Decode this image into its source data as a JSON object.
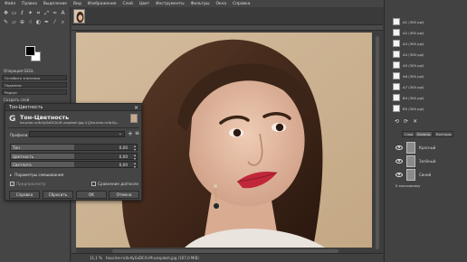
{
  "menubar": [
    "Файл",
    "Правка",
    "Выделение",
    "Вид",
    "Изображение",
    "Слой",
    "Цвет",
    "Инструменты",
    "Фильтры",
    "Окна",
    "Справка"
  ],
  "toolbox": {
    "tool_icons": [
      "move-icon",
      "rect-select-icon",
      "lasso-icon",
      "fuzzy-select-icon",
      "crop-icon",
      "transform-icon",
      "warp-icon",
      "text-icon",
      "paintbrush-icon",
      "eraser-icon",
      "clone-icon",
      "smudge-icon",
      "dodge-icon",
      "path-icon",
      "picker-icon",
      "zoom-icon"
    ],
    "option_1": "Ослабить значения",
    "option_2": "Подменю",
    "radius_label": "Радиус",
    "merge_label": "Объединять",
    "create_layer": "Создать слой",
    "gegl_label": "Операция GEGL"
  },
  "status": {
    "zoom": "11,1 %",
    "filename": "houcine-ncib-KyGsDCAi-M-unsplash.jpg (167,0 MiB)"
  },
  "history": {
    "items": [
      "A1 (300 ppi)",
      "A2 (300 ppi)",
      "A3 (300 ppi)",
      "A4 (300 ppi)",
      "A5 (300 ppi)",
      "A6 (300 ppi)",
      "A7 (300 ppi)",
      "B4 (300 ppi)",
      "B5 (300 ppi)"
    ]
  },
  "panel_tabs": {
    "layers": "Слои",
    "channels": "Каналы",
    "paths": "Контуры"
  },
  "channels": {
    "items": [
      "Красный",
      "Зелёный",
      "Синий"
    ]
  },
  "panel_footer": "Б маскировку",
  "dialog": {
    "window_title": "Тон-Цветность",
    "heading": "Тон-Цветность",
    "subtitle": "houcine-ncib-KyGsDCAi-M-unsplash.jpg-4 ([houcine-ncib-Ky...",
    "presets_label": "Профили:",
    "sliders": [
      {
        "label": "Тон",
        "value": "0,00",
        "fraction": 0.5
      },
      {
        "label": "Цветность",
        "value": "0,00",
        "fraction": 0.5
      },
      {
        "label": "Светлота",
        "value": "0,00",
        "fraction": 0.5
      }
    ],
    "blend_label": "Параметры смешивания",
    "preview_label": "Предпросмотр",
    "preview_checked": true,
    "split_label": "Сравнение до/после",
    "split_checked": false,
    "buttons": {
      "help": "Справка",
      "reset": "Сбросить",
      "ok": "OK",
      "cancel": "Отмена"
    }
  }
}
